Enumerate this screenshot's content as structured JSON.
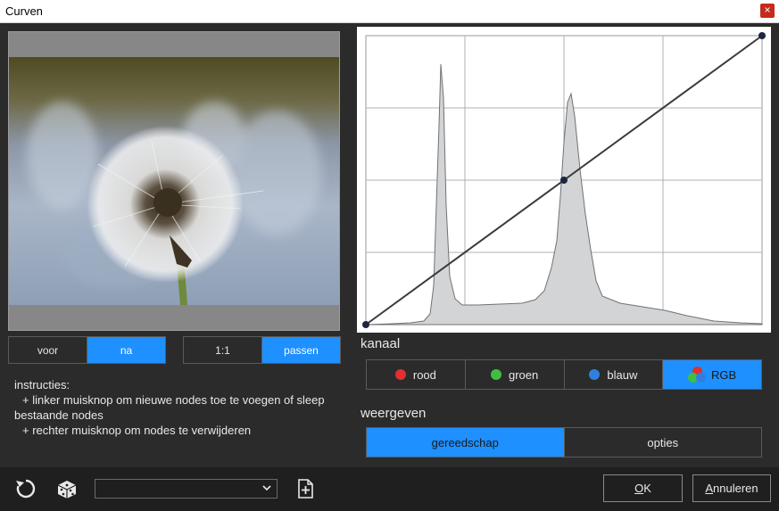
{
  "window": {
    "title": "Curven",
    "close_glyph": "×"
  },
  "preview": {
    "toggle_left": {
      "options": [
        "voor",
        "na"
      ],
      "selected": "na"
    },
    "toggle_right": {
      "options": [
        "1:1",
        "passen"
      ],
      "selected": "passen"
    }
  },
  "instructions": {
    "line1": "instructies:",
    "line2": "+ linker muisknop om nieuwe nodes toe te voegen of sleep",
    "line3": "bestaande nodes",
    "line4": "+ rechter muisknop om nodes te verwijderen"
  },
  "kanaal": {
    "label": "kanaal",
    "channels": [
      {
        "label": "rood",
        "color": "#e03030"
      },
      {
        "label": "groen",
        "color": "#3fbf3f"
      },
      {
        "label": "blauw",
        "color": "#2f7fe0"
      },
      {
        "label": "RGB",
        "color": ""
      }
    ],
    "selected": "RGB"
  },
  "weergeven": {
    "label": "weergeven",
    "options": [
      "gereedschap",
      "opties"
    ],
    "selected": "gereedschap"
  },
  "footer": {
    "preset_value": "",
    "ok_mnemonic": "O",
    "ok_rest": "K",
    "cancel_mnemonic": "A",
    "cancel_rest": "nnuleren"
  },
  "icons": {
    "reset": "reset-icon",
    "random": "dice-icon",
    "new_preset": "new-file-icon",
    "dropdown": "chevron-down-icon"
  },
  "colors": {
    "accent": "#1e90ff",
    "background": "#2b2b2b",
    "footer": "#1f1f1f"
  }
}
